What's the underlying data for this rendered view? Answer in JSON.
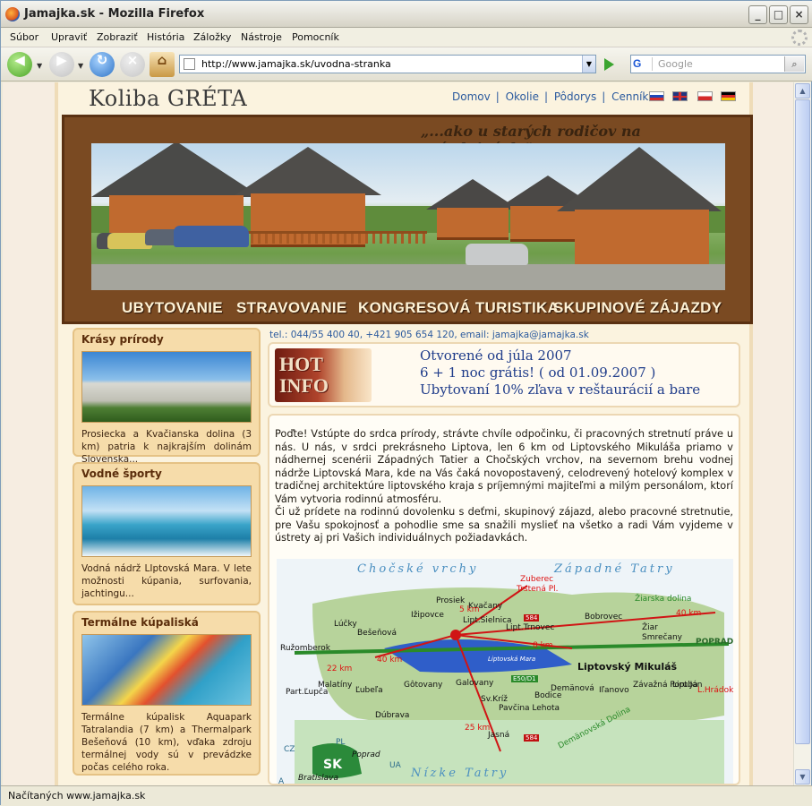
{
  "window": {
    "title": "Jamajka.sk - Mozilla Firefox"
  },
  "menu": [
    "Súbor",
    "Upraviť",
    "Zobraziť",
    "História",
    "Záložky",
    "Nástroje",
    "Pomocník"
  ],
  "toolbar": {
    "url": "http://www.jamajka.sk/uvodna-stranka",
    "search_placeholder": "Google",
    "search_engine": "G"
  },
  "status": {
    "text": "Načítaných www.jamajka.sk"
  },
  "site": {
    "brand": "Koliba GRÉTA",
    "nav": [
      "Domov",
      "Okolie",
      "Pôdorys",
      "Cenník"
    ],
    "slogan": "„...ako u starých rodičov na prázdninách.\"",
    "banner_menu": [
      "UBYTOVANIE",
      "STRAVOVANIE",
      "KONGRESOVÁ TURISTIKA",
      "SKUPINOVÉ ZÁJAZDY"
    ],
    "contact": "tel.: 044/55 400 40, +421 905 654 120, email: jamajka@jamajka.sk",
    "hot": {
      "image_text_1": "HOT",
      "image_text_2": "INFO",
      "lines": [
        "Otvorené od júla 2007",
        "6 + 1 noc grátis! ( od 01.09.2007 )",
        "Ubytovaní 10% zľava v reštaurácií a bare"
      ]
    },
    "intro_1": "Poďte! Vstúpte do srdca prírody, strávte chvíle odpočinku, či pracovných stretnutí práve u nás. U nás, v srdci prekrásneho Liptova, len 6 km od Liptovského Mikuláša priamo v nádhernej scenérii Západných Tatier a Chočských vrchov, na severnom brehu vodnej nádrže Liptovská Mara, kde na Vás čaká novopostavený, celodrevený hotelový komplex v tradičnej architektúre liptovského kraja s príjemnými majiteľmi a milým personálom, ktorí Vám vytvoria rodinnú atmosféru.",
    "intro_2": "Či už prídete na rodinnú dovolenku s deťmi, skupinový zájazd, alebo pracovné stretnutie, pre Vašu spokojnosť a pohodlie sme sa snažili myslieť na všetko a radi Vám vyjdeme v ústrety aj pri Vašich individuálnych požiadavkách.",
    "sidebar": [
      {
        "title": "Krásy prírody",
        "text": "Prosiecka a Kvačianska dolina (3 km) patria k najkrajším dolinám Slovenska..."
      },
      {
        "title": "Vodné športy",
        "text": "Vodná nádrž LIptovská Mara. V lete možnosti kúpania, surfovania, jachtingu..."
      },
      {
        "title": "Termálne kúpaliská",
        "text": "Termálne kúpalisk Aquapark Tatralandia (7 km) a Thermalpark Bešeňová (10 km), vďaka zdroju termálnej vody sú v prevádzke počas celého roka."
      }
    ],
    "map": {
      "title_left": "Chočské vrchy",
      "title_right": "Západné Tatry",
      "title_bottom": "Nízke Tatry",
      "places": [
        "Zuberec",
        "Trstená Pl.",
        "Prosiek",
        "Kvačany",
        "Lúčky",
        "Bešeňová",
        "Ružomberok",
        "Lipt.Sielnica",
        "Lipt.Trnovec",
        "Bobrovec",
        "Žiar",
        "Smrečany",
        "Liptovský Mikuláš",
        "Galovany",
        "Gôtovany",
        "Malatíny",
        "Ľubeľa",
        "Part.Ľupča",
        "Dúbrava",
        "Sv.Kríž",
        "Pavčina Lehota",
        "Bodice",
        "Demänová",
        "Iľanovo",
        "Závažná Poruba",
        "Lipt.Ján",
        "L.Hrádok",
        "Jasná",
        "Liptovská Mara",
        "Ižipovce",
        "Žiarska dolina",
        "Demänovská Dolina",
        "POPRAD",
        "Poprad",
        "Bratislava"
      ],
      "distances": [
        "5 km",
        "8 km",
        "40 km",
        "40 km",
        "22 km",
        "25 km"
      ],
      "roads": [
        "584",
        "E50/D1",
        "584"
      ],
      "countries": [
        "SK",
        "CZ",
        "PL",
        "UA",
        "A"
      ]
    }
  }
}
